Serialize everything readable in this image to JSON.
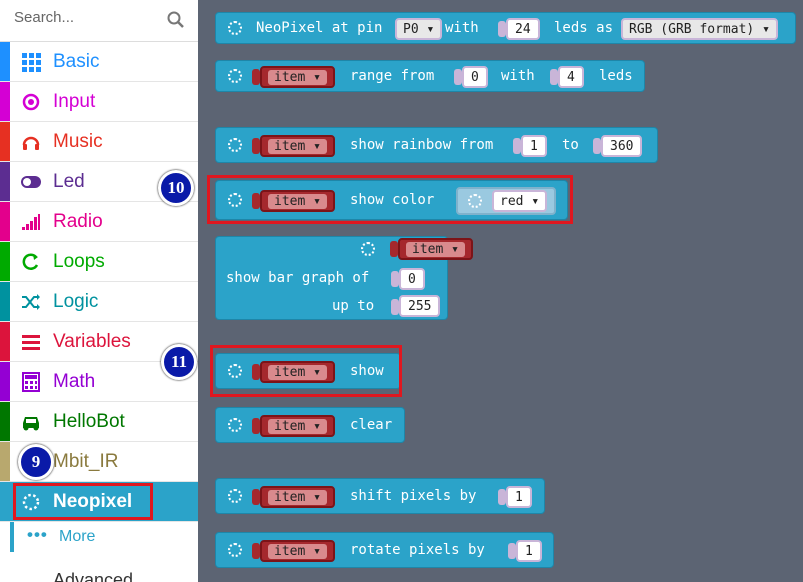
{
  "sidebar": {
    "search_placeholder": "Search...",
    "categories": [
      {
        "label": "Basic",
        "icon": "grid-icon",
        "color": "#1e90ff"
      },
      {
        "label": "Input",
        "icon": "input-circle-icon",
        "color": "#d400d4"
      },
      {
        "label": "Music",
        "icon": "headphones-icon",
        "color": "#e63022"
      },
      {
        "label": "Led",
        "icon": "toggle-icon",
        "color": "#5c2d91"
      },
      {
        "label": "Radio",
        "icon": "signal-bars-icon",
        "color": "#e3008c"
      },
      {
        "label": "Loops",
        "icon": "loop-arrow-icon",
        "color": "#00aa00"
      },
      {
        "label": "Logic",
        "icon": "shuffle-icon",
        "color": "#00929f"
      },
      {
        "label": "Variables",
        "icon": "list-lines-icon",
        "color": "#dc143c"
      },
      {
        "label": "Math",
        "icon": "calculator-icon",
        "color": "#9400d3"
      },
      {
        "label": "HelloBot",
        "icon": "car-icon",
        "color": "#007700"
      },
      {
        "label": "Mbit_IR",
        "icon": "remote-icon",
        "color": "#b8a86e"
      },
      {
        "label": "Neopixel",
        "icon": "neopixel-dots-icon",
        "color": "#2ba3c9"
      }
    ],
    "more_label": "More",
    "advanced_label": "Advanced"
  },
  "workspace": {
    "block1": {
      "prefix": "NeoPixel at pin",
      "pin": "P0",
      "mid": "with",
      "leds": "24",
      "suffix": "leds as",
      "mode": "RGB (GRB format)"
    },
    "block2": {
      "var": "item",
      "text1": "range from",
      "from": "0",
      "text2": "with",
      "count": "4",
      "text3": "leds"
    },
    "block3": {
      "var": "item",
      "text1": "show rainbow from",
      "from": "1",
      "text2": "to",
      "to": "360"
    },
    "block4": {
      "var": "item",
      "text1": "show color",
      "color": "red"
    },
    "block5": {
      "var": "item",
      "line1": "show bar graph of",
      "value": "0",
      "line2": "up to",
      "max": "255"
    },
    "block6": {
      "var": "item",
      "text1": "show"
    },
    "block7": {
      "var": "item",
      "text1": "clear"
    },
    "block8": {
      "var": "item",
      "text1": "shift pixels by",
      "value": "1"
    },
    "block9": {
      "var": "item",
      "text1": "rotate pixels by",
      "value": "1"
    }
  },
  "badges": {
    "b9": "9",
    "b10": "10",
    "b11": "11"
  },
  "dropdown_arrow": "▾"
}
